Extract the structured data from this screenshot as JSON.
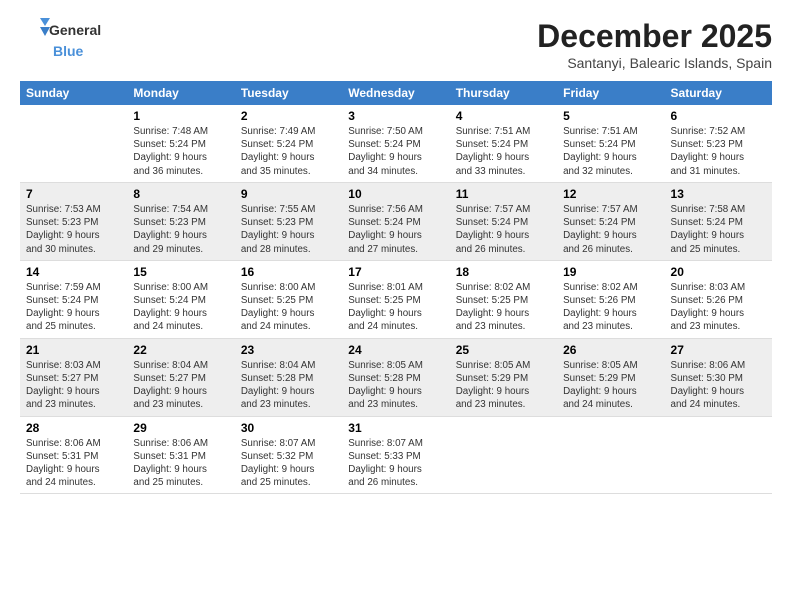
{
  "header": {
    "logo_line1": "General",
    "logo_line2": "Blue",
    "month": "December 2025",
    "location": "Santanyi, Balearic Islands, Spain"
  },
  "days_of_week": [
    "Sunday",
    "Monday",
    "Tuesday",
    "Wednesday",
    "Thursday",
    "Friday",
    "Saturday"
  ],
  "weeks": [
    [
      {
        "day": "",
        "info": ""
      },
      {
        "day": "1",
        "info": "Sunrise: 7:48 AM\nSunset: 5:24 PM\nDaylight: 9 hours\nand 36 minutes."
      },
      {
        "day": "2",
        "info": "Sunrise: 7:49 AM\nSunset: 5:24 PM\nDaylight: 9 hours\nand 35 minutes."
      },
      {
        "day": "3",
        "info": "Sunrise: 7:50 AM\nSunset: 5:24 PM\nDaylight: 9 hours\nand 34 minutes."
      },
      {
        "day": "4",
        "info": "Sunrise: 7:51 AM\nSunset: 5:24 PM\nDaylight: 9 hours\nand 33 minutes."
      },
      {
        "day": "5",
        "info": "Sunrise: 7:51 AM\nSunset: 5:24 PM\nDaylight: 9 hours\nand 32 minutes."
      },
      {
        "day": "6",
        "info": "Sunrise: 7:52 AM\nSunset: 5:23 PM\nDaylight: 9 hours\nand 31 minutes."
      }
    ],
    [
      {
        "day": "7",
        "info": "Sunrise: 7:53 AM\nSunset: 5:23 PM\nDaylight: 9 hours\nand 30 minutes."
      },
      {
        "day": "8",
        "info": "Sunrise: 7:54 AM\nSunset: 5:23 PM\nDaylight: 9 hours\nand 29 minutes."
      },
      {
        "day": "9",
        "info": "Sunrise: 7:55 AM\nSunset: 5:23 PM\nDaylight: 9 hours\nand 28 minutes."
      },
      {
        "day": "10",
        "info": "Sunrise: 7:56 AM\nSunset: 5:24 PM\nDaylight: 9 hours\nand 27 minutes."
      },
      {
        "day": "11",
        "info": "Sunrise: 7:57 AM\nSunset: 5:24 PM\nDaylight: 9 hours\nand 26 minutes."
      },
      {
        "day": "12",
        "info": "Sunrise: 7:57 AM\nSunset: 5:24 PM\nDaylight: 9 hours\nand 26 minutes."
      },
      {
        "day": "13",
        "info": "Sunrise: 7:58 AM\nSunset: 5:24 PM\nDaylight: 9 hours\nand 25 minutes."
      }
    ],
    [
      {
        "day": "14",
        "info": "Sunrise: 7:59 AM\nSunset: 5:24 PM\nDaylight: 9 hours\nand 25 minutes."
      },
      {
        "day": "15",
        "info": "Sunrise: 8:00 AM\nSunset: 5:24 PM\nDaylight: 9 hours\nand 24 minutes."
      },
      {
        "day": "16",
        "info": "Sunrise: 8:00 AM\nSunset: 5:25 PM\nDaylight: 9 hours\nand 24 minutes."
      },
      {
        "day": "17",
        "info": "Sunrise: 8:01 AM\nSunset: 5:25 PM\nDaylight: 9 hours\nand 24 minutes."
      },
      {
        "day": "18",
        "info": "Sunrise: 8:02 AM\nSunset: 5:25 PM\nDaylight: 9 hours\nand 23 minutes."
      },
      {
        "day": "19",
        "info": "Sunrise: 8:02 AM\nSunset: 5:26 PM\nDaylight: 9 hours\nand 23 minutes."
      },
      {
        "day": "20",
        "info": "Sunrise: 8:03 AM\nSunset: 5:26 PM\nDaylight: 9 hours\nand 23 minutes."
      }
    ],
    [
      {
        "day": "21",
        "info": "Sunrise: 8:03 AM\nSunset: 5:27 PM\nDaylight: 9 hours\nand 23 minutes."
      },
      {
        "day": "22",
        "info": "Sunrise: 8:04 AM\nSunset: 5:27 PM\nDaylight: 9 hours\nand 23 minutes."
      },
      {
        "day": "23",
        "info": "Sunrise: 8:04 AM\nSunset: 5:28 PM\nDaylight: 9 hours\nand 23 minutes."
      },
      {
        "day": "24",
        "info": "Sunrise: 8:05 AM\nSunset: 5:28 PM\nDaylight: 9 hours\nand 23 minutes."
      },
      {
        "day": "25",
        "info": "Sunrise: 8:05 AM\nSunset: 5:29 PM\nDaylight: 9 hours\nand 23 minutes."
      },
      {
        "day": "26",
        "info": "Sunrise: 8:05 AM\nSunset: 5:29 PM\nDaylight: 9 hours\nand 24 minutes."
      },
      {
        "day": "27",
        "info": "Sunrise: 8:06 AM\nSunset: 5:30 PM\nDaylight: 9 hours\nand 24 minutes."
      }
    ],
    [
      {
        "day": "28",
        "info": "Sunrise: 8:06 AM\nSunset: 5:31 PM\nDaylight: 9 hours\nand 24 minutes."
      },
      {
        "day": "29",
        "info": "Sunrise: 8:06 AM\nSunset: 5:31 PM\nDaylight: 9 hours\nand 25 minutes."
      },
      {
        "day": "30",
        "info": "Sunrise: 8:07 AM\nSunset: 5:32 PM\nDaylight: 9 hours\nand 25 minutes."
      },
      {
        "day": "31",
        "info": "Sunrise: 8:07 AM\nSunset: 5:33 PM\nDaylight: 9 hours\nand 26 minutes."
      },
      {
        "day": "",
        "info": ""
      },
      {
        "day": "",
        "info": ""
      },
      {
        "day": "",
        "info": ""
      }
    ]
  ]
}
